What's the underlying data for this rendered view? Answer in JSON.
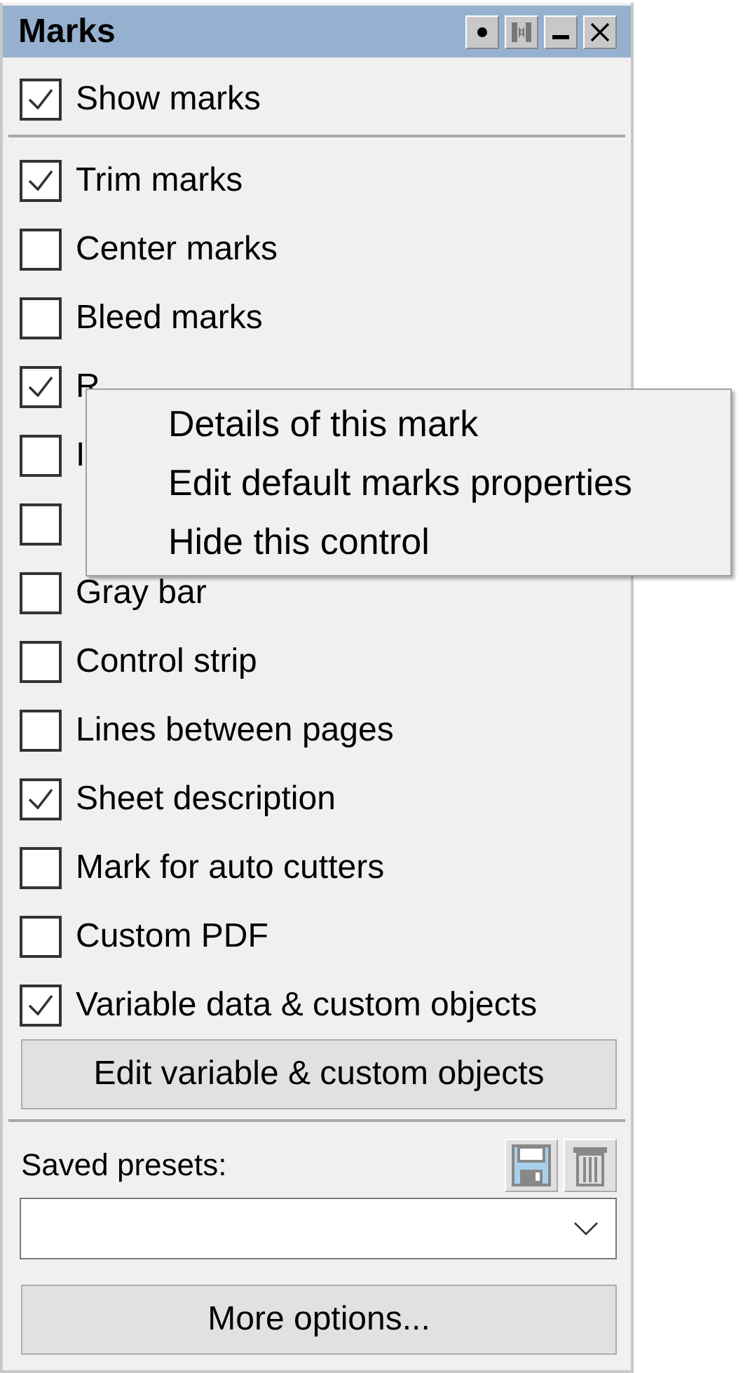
{
  "window": {
    "title": "Marks"
  },
  "show_marks": {
    "label": "Show marks",
    "checked": true
  },
  "marks": [
    {
      "label": "Trim marks",
      "checked": true
    },
    {
      "label": "Center marks",
      "checked": false
    },
    {
      "label": "Bleed marks",
      "checked": false
    },
    {
      "label": "R",
      "checked": true
    },
    {
      "label": "I",
      "checked": false
    },
    {
      "checked": false
    },
    {
      "label": "Gray bar",
      "checked": false
    },
    {
      "label": "Control strip",
      "checked": false
    },
    {
      "label": "Lines between pages",
      "checked": false
    },
    {
      "label": "Sheet description",
      "checked": true
    },
    {
      "label": "Mark for auto cutters",
      "checked": false
    },
    {
      "label": "Custom PDF",
      "checked": false
    },
    {
      "label": "Variable data & custom objects",
      "checked": true
    }
  ],
  "edit_button": "Edit variable & custom objects",
  "presets": {
    "label": "Saved presets:"
  },
  "more_button": "More options...",
  "context_menu": [
    "Details of this mark",
    "Edit default marks properties",
    "Hide this control"
  ]
}
